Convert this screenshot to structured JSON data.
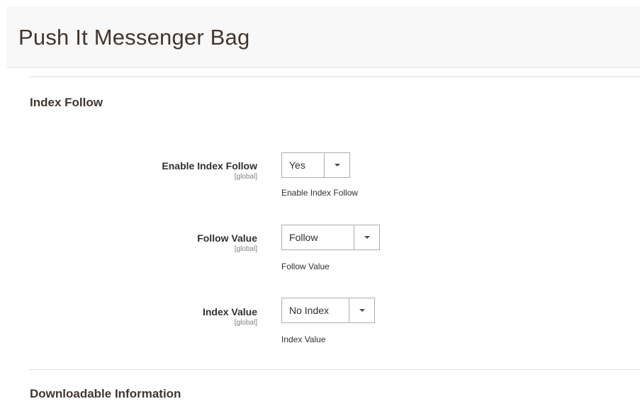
{
  "header": {
    "title": "Push It Messenger Bag"
  },
  "sections": {
    "index_follow": {
      "title": "Index Follow"
    },
    "downloadable": {
      "title": "Downloadable Information"
    }
  },
  "fields": [
    {
      "label": "Enable Index Follow",
      "scope": "[global]",
      "value": "Yes",
      "note": "Enable Index Follow"
    },
    {
      "label": "Follow Value",
      "scope": "[global]",
      "value": "Follow",
      "note": "Follow Value"
    },
    {
      "label": "Index Value",
      "scope": "[global]",
      "value": "No Index",
      "note": "Index Value"
    }
  ],
  "colors": {
    "header_bg": "#f8f8f8",
    "title": "#41362f",
    "border": "#adadad"
  },
  "icons": {
    "select_arrow": "caret-down-icon"
  }
}
